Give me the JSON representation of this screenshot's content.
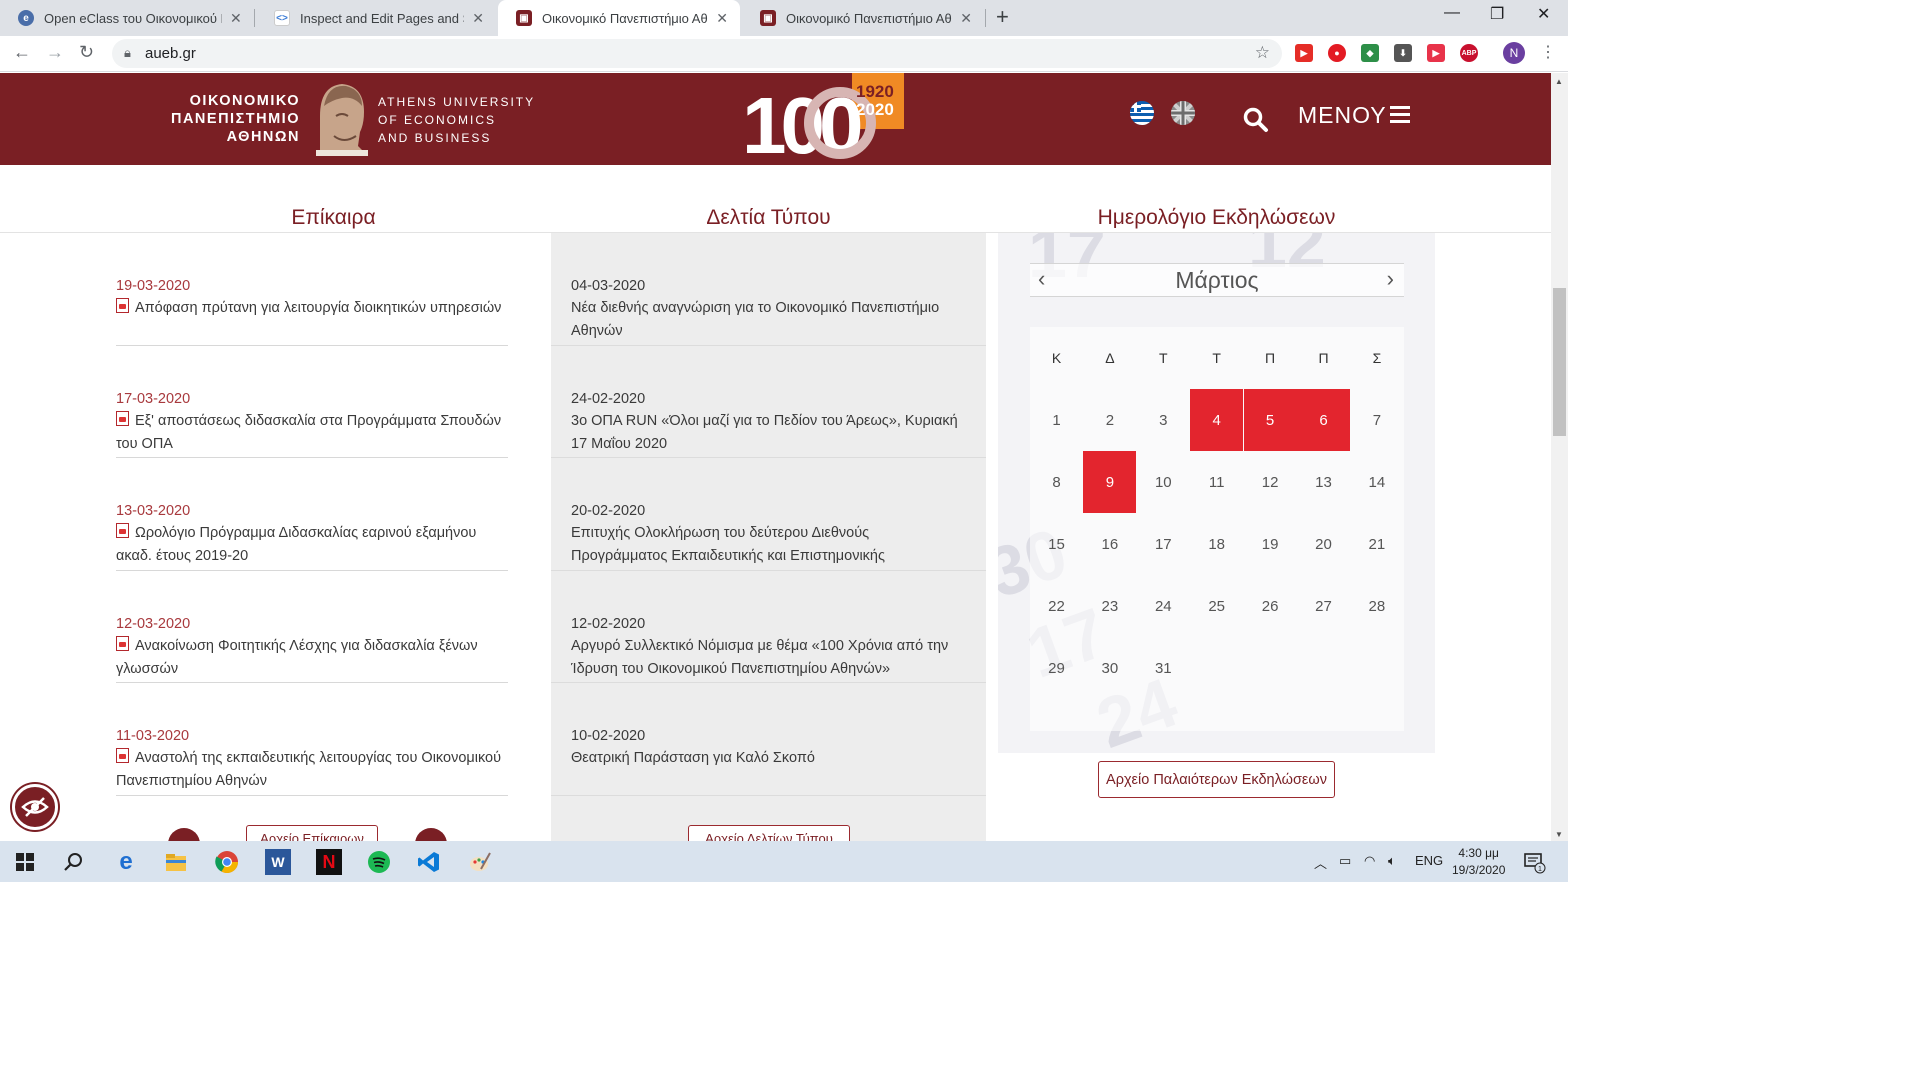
{
  "browser": {
    "tabs": [
      {
        "title": "Open eClass του Οικονομικού Πανεπιστημίου",
        "active": false
      },
      {
        "title": "Inspect and Edit Pages and Styles",
        "active": false
      },
      {
        "title": "Οικονομικό Πανεπιστήμιο Αθηνών",
        "active": true
      },
      {
        "title": "Οικονομικό Πανεπιστήμιο Αθηνών",
        "active": false
      }
    ],
    "url": "aueb.gr",
    "profile_initial": "N"
  },
  "header": {
    "logo_greek": [
      "ΟΙΚΟΝΟΜΙΚΟ",
      "ΠΑΝΕΠΙΣΤΗΜΙΟ",
      "ΑΘΗΝΩΝ"
    ],
    "logo_english": [
      "ATHENS UNIVERSITY",
      "OF ECONOMICS",
      "AND BUSINESS"
    ],
    "anniversary_main": "100",
    "anniversary_years": [
      "1920",
      "2020"
    ],
    "menu_label": "ΜΕΝΟΥ",
    "colors": {
      "brand": "#7a1f24",
      "accent_orange": "#f08a24"
    }
  },
  "columns": {
    "news_title": "Επίκαιρα",
    "press_title": "Δελτία Τύπου",
    "calendar_title": "Ημερολόγιο Εκδηλώσεων"
  },
  "news": [
    {
      "date": "19-03-2020",
      "text": "Απόφαση πρύτανη για λειτουργία διοικητικών υπηρεσιών"
    },
    {
      "date": "17-03-2020",
      "text": "Εξ' αποστάσεως διδασκαλία στα Προγράμματα Σπουδών του ΟΠΑ"
    },
    {
      "date": "13-03-2020",
      "text": "Ωρολόγιο Πρόγραμμα Διδασκαλίας εαρινού εξαμήνου ακαδ. έτους 2019-20"
    },
    {
      "date": "12-03-2020",
      "text": "Ανακοίνωση Φοιτητικής Λέσχης για διδασκαλία ξένων γλωσσών"
    },
    {
      "date": "11-03-2020",
      "text": "Αναστολή της εκπαιδευτικής λειτουργίας του Οικονομικού Πανεπιστημίου Αθηνών"
    }
  ],
  "news_archive_label": "Αρχείο Επίκαιρων",
  "press": [
    {
      "date": "04-03-2020",
      "text": "Νέα διεθνής αναγνώριση για το Οικονομικό Πανεπιστήμιο Αθηνών"
    },
    {
      "date": "24-02-2020",
      "text": "3ο ΟΠΑ RUN «Όλοι μαζί για το Πεδίον του Άρεως», Κυριακή 17 Μαΐου 2020"
    },
    {
      "date": "20-02-2020",
      "text": "Επιτυχής Ολοκλήρωση του δεύτερου Διεθνούς Προγράμματος Εκπαιδευτικής και Επιστημονικής συνεργασίας του Οικονομικού Πανεπιστημίου Αθηνών με το"
    },
    {
      "date": "12-02-2020",
      "text": "Αργυρό Συλλεκτικό Νόμισμα με θέμα «100 Χρόνια από την Ίδρυση του Οικονομικού Πανεπιστημίου Αθηνών»"
    },
    {
      "date": "10-02-2020",
      "text": "Θεατρική Παράσταση για Καλό Σκοπό"
    }
  ],
  "press_archive_label": "Αρχείο Δελτίων Τύπου",
  "calendar": {
    "month": "Μάρτιος",
    "weekdays": [
      "Κ",
      "Δ",
      "Τ",
      "Τ",
      "Π",
      "Π",
      "Σ"
    ],
    "weeks": [
      [
        "1",
        "2",
        "3",
        "4",
        "5",
        "6",
        "7"
      ],
      [
        "8",
        "9",
        "10",
        "11",
        "12",
        "13",
        "14"
      ],
      [
        "15",
        "16",
        "17",
        "18",
        "19",
        "20",
        "21"
      ],
      [
        "22",
        "23",
        "24",
        "25",
        "26",
        "27",
        "28"
      ],
      [
        "29",
        "30",
        "31",
        "",
        "",
        "",
        ""
      ]
    ],
    "highlighted": [
      "4",
      "5",
      "6",
      "9"
    ],
    "highlight_color": "#e3252e",
    "archive_label": "Αρχείο Παλαιότερων Εκδηλώσεων"
  },
  "taskbar": {
    "lang": "ENG",
    "time": "4:30 μμ",
    "date": "19/3/2020",
    "notification_count": "1"
  }
}
